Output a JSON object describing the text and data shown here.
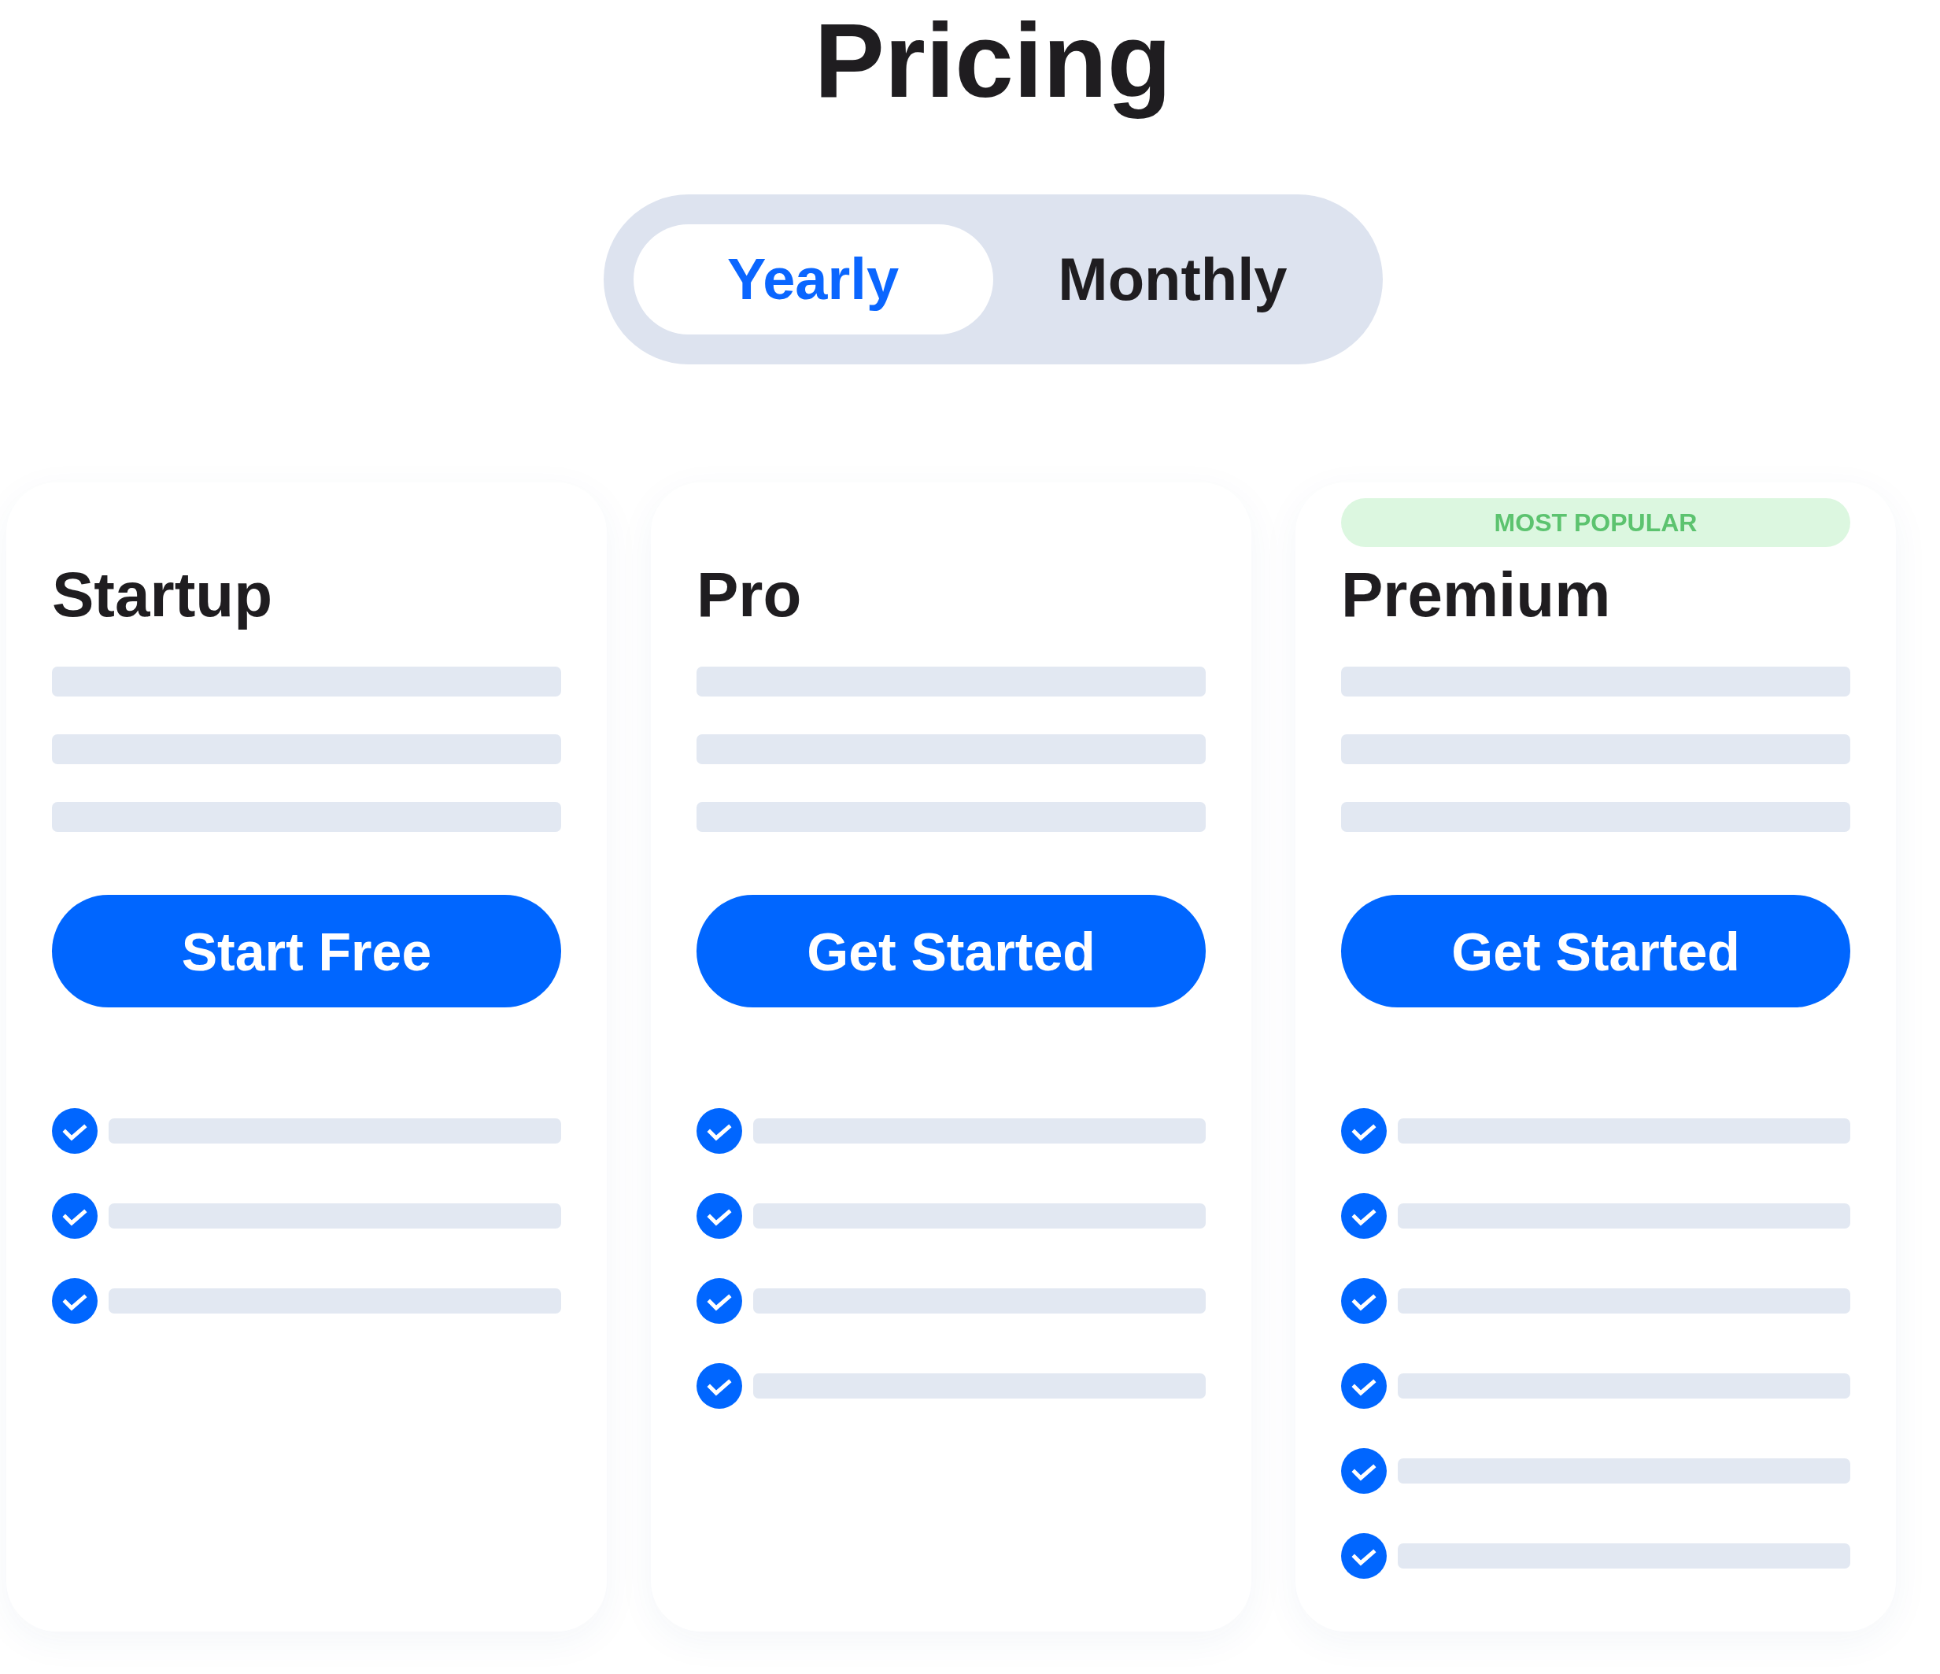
{
  "title": "Pricing",
  "billing_toggle": [
    {
      "label": "Yearly",
      "selected": true
    },
    {
      "label": "Monthly",
      "selected": false
    }
  ],
  "plans": [
    {
      "name": "Startup",
      "button": "Start Free",
      "features": [
        {
          "checked": true
        },
        {
          "checked": true
        },
        {
          "checked": true
        }
      ]
    },
    {
      "name": "Pro",
      "button": "Get Started",
      "features": [
        {
          "checked": true
        },
        {
          "checked": true
        },
        {
          "checked": true
        },
        {
          "checked": true
        }
      ]
    },
    {
      "badge": "MOST POPULAR",
      "name": "Premium",
      "button": "Get Started",
      "features": [
        {
          "checked": true
        },
        {
          "checked": true
        },
        {
          "checked": true
        },
        {
          "checked": true
        },
        {
          "checked": true
        },
        {
          "checked": true
        }
      ]
    }
  ]
}
